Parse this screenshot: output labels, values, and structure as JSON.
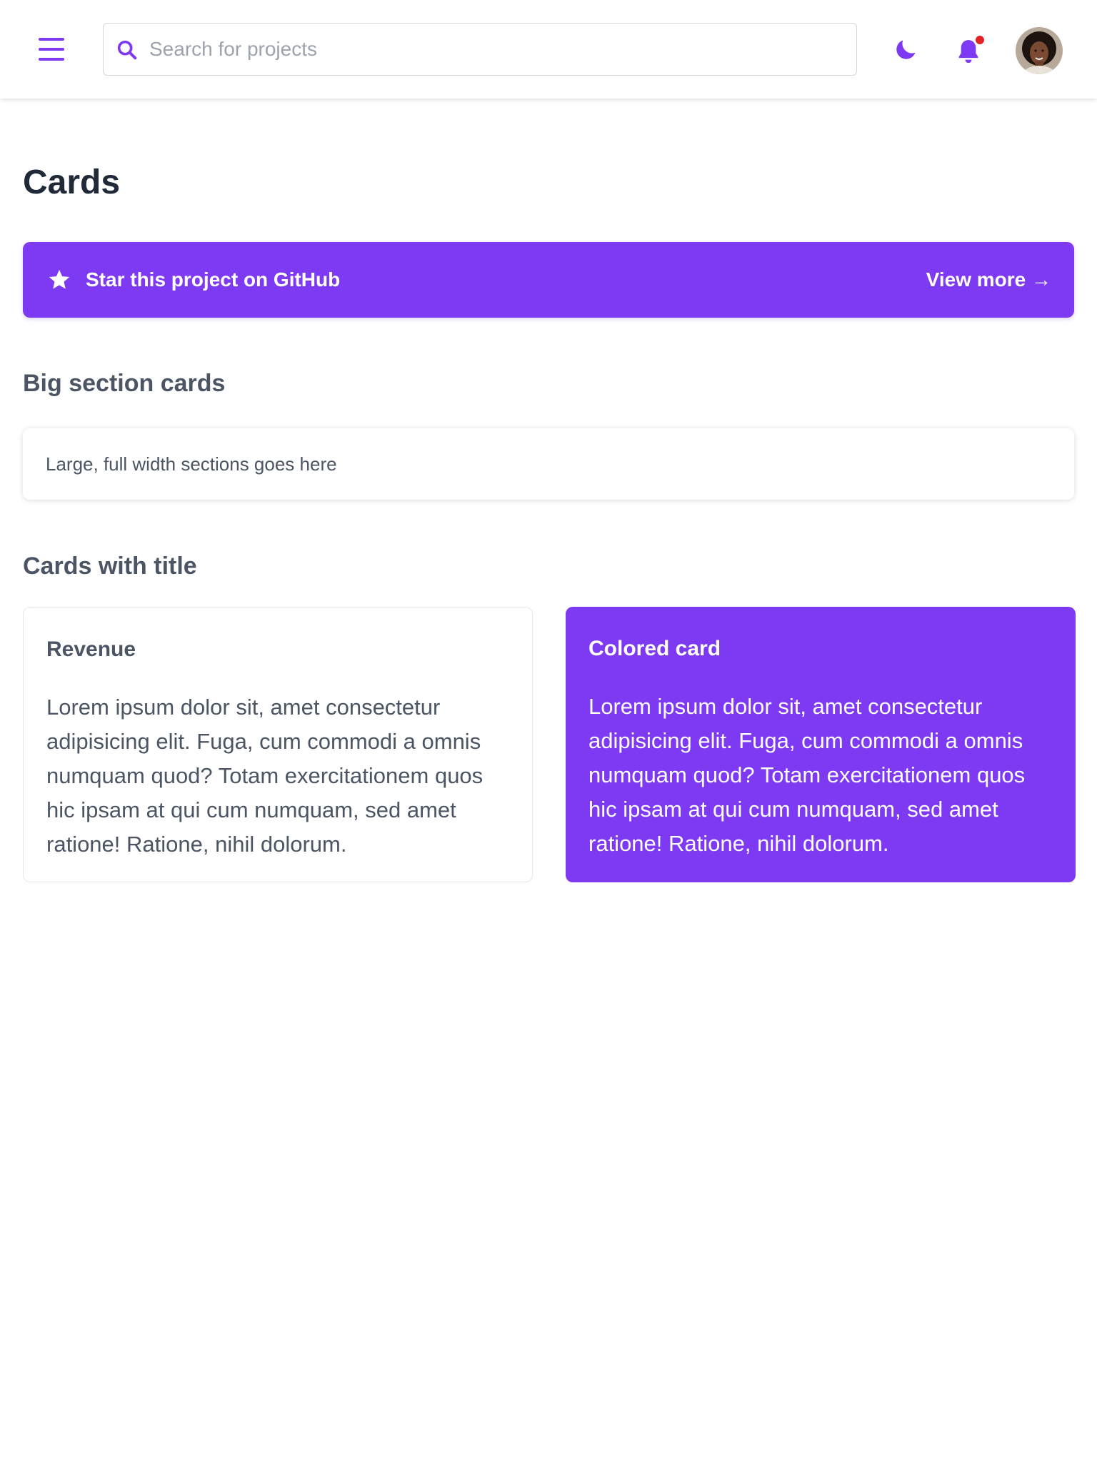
{
  "header": {
    "search": {
      "placeholder": "Search for projects",
      "value": ""
    },
    "icons": {
      "menu": "menu-icon",
      "search": "search-icon",
      "theme": "moon-icon",
      "notifications": "bell-icon",
      "avatar": "user-avatar"
    },
    "accent_color": "#7e3af2",
    "notification_dot_color": "#e02424"
  },
  "main": {
    "page_title": "Cards",
    "cta": {
      "label": "Star this project on GitHub",
      "link": "View more →",
      "icon": "star-icon",
      "color": "#7e3af2"
    },
    "big_section": {
      "heading": "Big section cards",
      "text": "Large, full width sections goes here"
    },
    "titled_section": {
      "heading": "Cards with title",
      "cards": [
        {
          "title": "Revenue",
          "body": "Lorem ipsum dolor sit, amet consectetur adipisicing elit. Fuga, cum commodi a omnis numquam quod? Totam exercitationem quos hic ipsam at qui cum numquam, sed amet ratione! Ratione, nihil dolorum."
        },
        {
          "title": "Colored card",
          "body": "Lorem ipsum dolor sit, amet consectetur adipisicing elit. Fuga, cum commodi a omnis numquam quod? Totam exercitationem quos hic ipsam at qui cum numquam, sed amet ratione! Ratione, nihil dolorum.",
          "background": "#7e3af2"
        }
      ]
    }
  }
}
